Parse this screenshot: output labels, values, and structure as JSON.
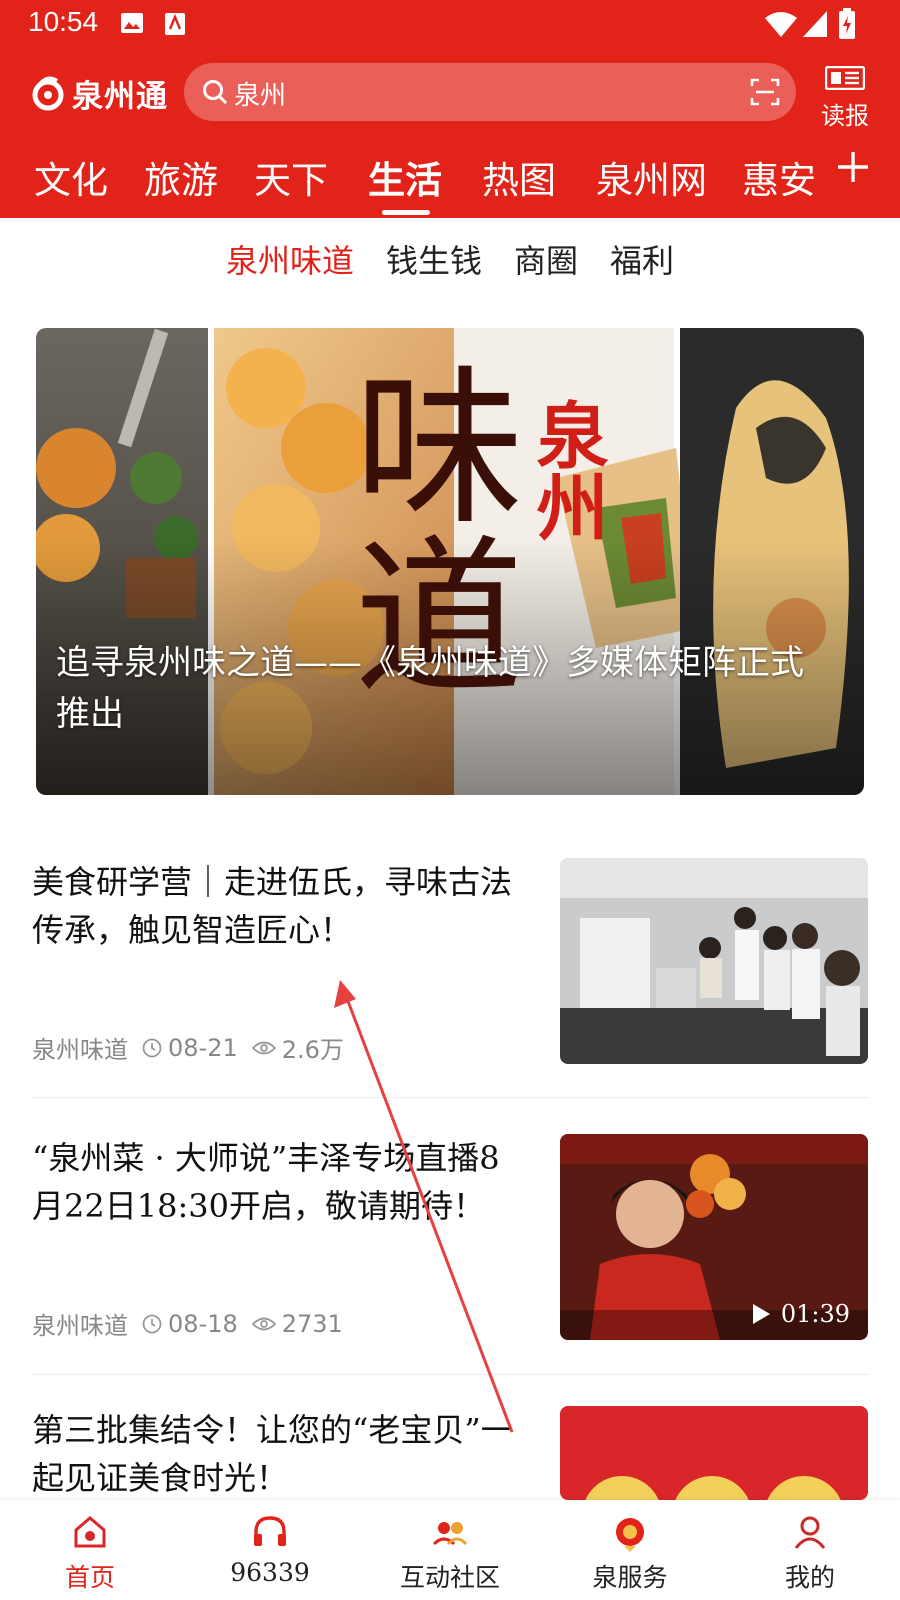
{
  "status_bar": {
    "time": "10:54"
  },
  "header": {
    "app_name": "泉州通",
    "search_query": "泉州",
    "read_paper_label": "读报"
  },
  "channel_tabs": [
    {
      "label": "文化"
    },
    {
      "label": "旅游"
    },
    {
      "label": "天下"
    },
    {
      "label": "生活",
      "active": true
    },
    {
      "label": "热图"
    },
    {
      "label": "泉州网"
    },
    {
      "label": "惠安"
    }
  ],
  "sub_tabs": [
    {
      "label": "泉州味道",
      "active": true
    },
    {
      "label": "钱生钱"
    },
    {
      "label": "商圈"
    },
    {
      "label": "福利"
    }
  ],
  "hero": {
    "image_big_text": "味道",
    "image_small_text": "泉州",
    "caption": "追寻泉州味之道——《泉州味道》多媒体矩阵正式推出"
  },
  "articles": [
    {
      "title": "美食研学营｜走进伍氏，寻味古法传承，触见智造匠心！",
      "source": "泉州味道",
      "date": "08-21",
      "views": "2.6万"
    },
    {
      "title": "“泉州菜 · 大师说”丰泽专场直播8月22日18:30开启，敬请期待！",
      "source": "泉州味道",
      "date": "08-18",
      "views": "2731",
      "video_duration": "01:39"
    },
    {
      "title": "第三批集结令！让您的“老宝贝”一起见证美食时光！"
    }
  ],
  "bottom_nav": [
    {
      "label": "首页",
      "active": true,
      "icon": "home-icon"
    },
    {
      "label": "96339",
      "icon": "headphones-icon"
    },
    {
      "label": "互动社区",
      "icon": "community-icon"
    },
    {
      "label": "泉服务",
      "icon": "service-icon"
    },
    {
      "label": "我的",
      "icon": "profile-icon"
    }
  ],
  "colors": {
    "brand_red": "#e2231a",
    "text_dark": "#111111",
    "text_meta": "#888888"
  }
}
